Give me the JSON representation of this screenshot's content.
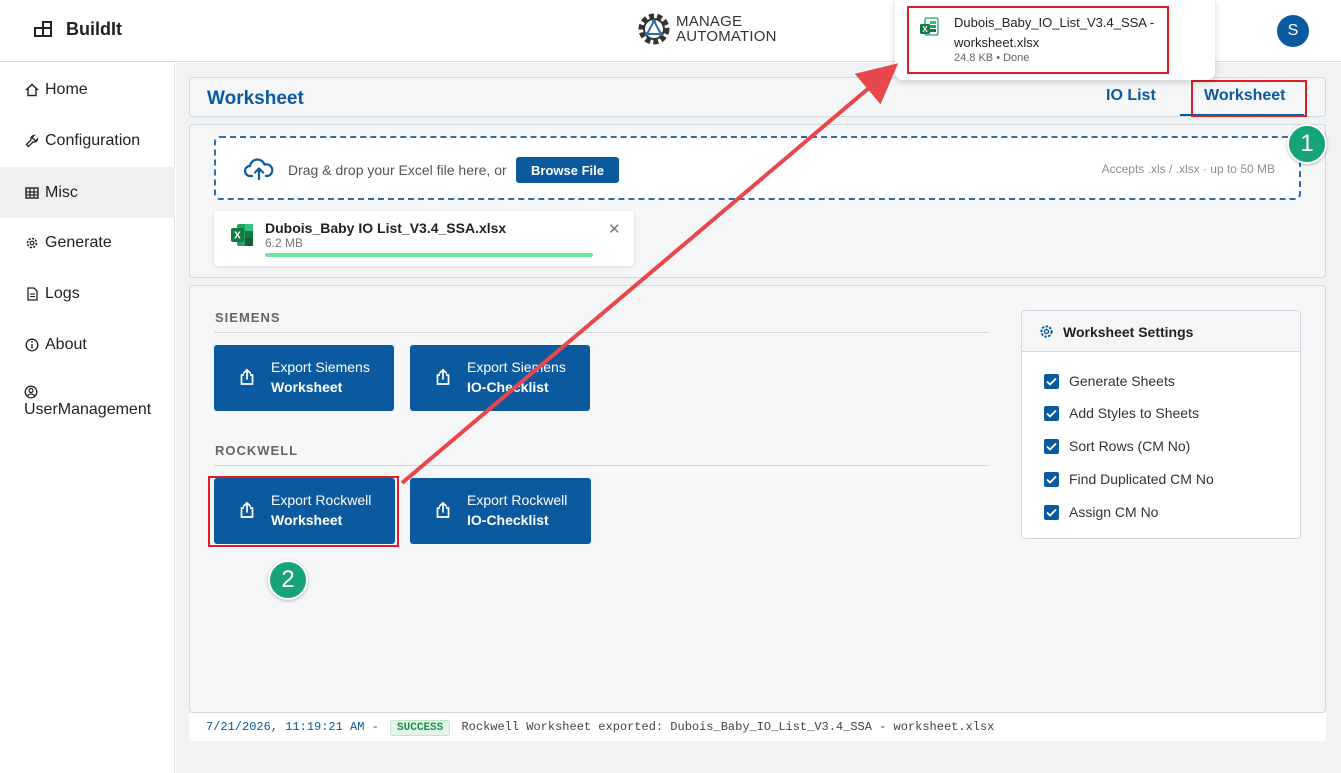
{
  "app": {
    "name": "BuildIt",
    "avatar_initial": "S"
  },
  "logo": {
    "line1": "MANAGE",
    "line2": "AUTOMATION"
  },
  "sidebar": {
    "items": [
      {
        "label": "Home",
        "icon": "home-icon"
      },
      {
        "label": "Configuration",
        "icon": "wrench-icon"
      },
      {
        "label": "Misc",
        "icon": "table-icon"
      },
      {
        "label": "Generate",
        "icon": "gear-icon"
      },
      {
        "label": "Logs",
        "icon": "document-icon"
      },
      {
        "label": "About",
        "icon": "info-icon"
      },
      {
        "label": "UserManagement",
        "icon": "user-circle-icon"
      }
    ],
    "active": "Misc"
  },
  "page": {
    "title": "Worksheet",
    "tabs": [
      {
        "label": "IO List"
      },
      {
        "label": "Worksheet"
      }
    ],
    "active_tab": "Worksheet"
  },
  "upload": {
    "drop_text": "Drag & drop your Excel file here, or",
    "browse_label": "Browse File",
    "accepts": "Accepts .xls / .xlsx  ·  up to 50 MB",
    "file": {
      "name": "Dubois_Baby IO List_V3.4_SSA.xlsx",
      "size": "6.2 MB",
      "progress": 1.0
    }
  },
  "sections": {
    "siemens": {
      "label": "SIEMENS",
      "buttons": [
        {
          "line1": "Export Siemens",
          "line2": "Worksheet"
        },
        {
          "line1": "Export Siemens",
          "line2": "IO-Checklist"
        }
      ]
    },
    "rockwell": {
      "label": "ROCKWELL",
      "buttons": [
        {
          "line1": "Export Rockwell",
          "line2": "Worksheet"
        },
        {
          "line1": "Export Rockwell",
          "line2": "IO-Checklist"
        }
      ]
    }
  },
  "settings": {
    "title": "Worksheet Settings",
    "options": [
      {
        "label": "Generate Sheets",
        "checked": true
      },
      {
        "label": "Add Styles to Sheets",
        "checked": true
      },
      {
        "label": "Sort Rows (CM No)",
        "checked": true
      },
      {
        "label": "Find Duplicated CM No",
        "checked": true
      },
      {
        "label": "Assign CM No",
        "checked": true
      }
    ]
  },
  "log": {
    "timestamp": "7/21/2026, 11:19:21 AM",
    "separator": "-",
    "status": "SUCCESS",
    "message": "Rockwell Worksheet exported: Dubois_Baby_IO_List_V3.4_SSA - worksheet.xlsx"
  },
  "download": {
    "filename": "Dubois_Baby_IO_List_V3.4_SSA - worksheet.xlsx",
    "meta": "24.8 KB • Done"
  },
  "annotations": {
    "marker1": "1",
    "marker2": "2"
  },
  "colors": {
    "primary": "#0b5aa0",
    "highlight": "#e01b24",
    "marker": "#16a37a",
    "success": "#1e8e4a"
  }
}
